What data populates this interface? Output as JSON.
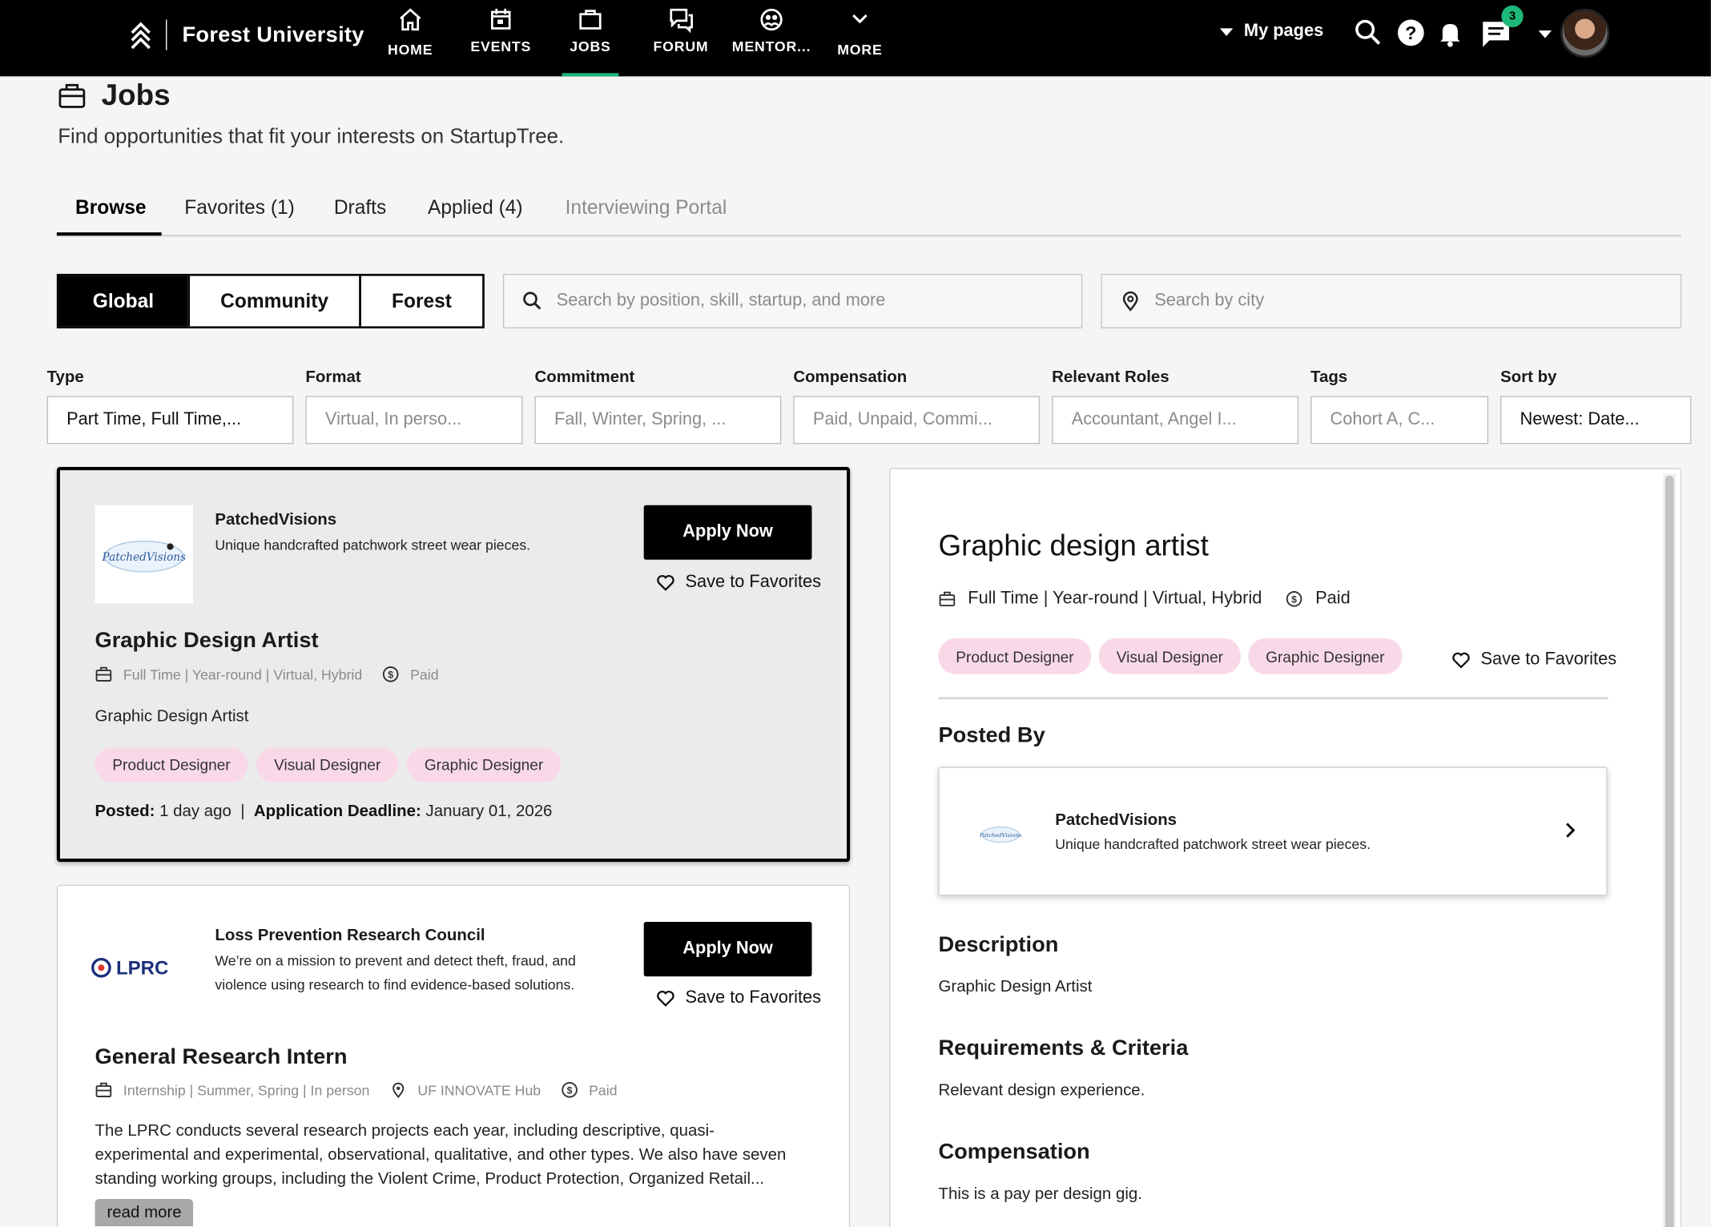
{
  "app": {
    "brand": "Forest University"
  },
  "nav": {
    "items": [
      {
        "label": "HOME",
        "icon": "home-icon"
      },
      {
        "label": "EVENTS",
        "icon": "calendar-icon"
      },
      {
        "label": "JOBS",
        "icon": "briefcase-icon",
        "active": true
      },
      {
        "label": "FORUM",
        "icon": "forum-icon"
      },
      {
        "label": "MENTOR...",
        "icon": "mentor-icon"
      },
      {
        "label": "MORE",
        "icon": "chevron-down-icon"
      }
    ],
    "my_pages": "My pages",
    "messages_badge": "3"
  },
  "page": {
    "title": "Jobs",
    "subtitle": "Find opportunities that fit your interests on StartupTree."
  },
  "tabs": [
    {
      "label": "Browse",
      "active": true
    },
    {
      "label": "Favorites (1)"
    },
    {
      "label": "Drafts"
    },
    {
      "label": "Applied (4)"
    },
    {
      "label": "Interviewing Portal",
      "disabled": true
    }
  ],
  "scope": {
    "options": [
      "Global",
      "Community",
      "Forest"
    ],
    "selected": "Global"
  },
  "search": {
    "placeholder": "Search by position, skill, startup, and more",
    "city_placeholder": "Search by city"
  },
  "filters": [
    {
      "label": "Type",
      "value": "Part Time, Full Time,..."
    },
    {
      "label": "Format",
      "value": "Virtual, In perso..."
    },
    {
      "label": "Commitment",
      "value": "Fall, Winter, Spring, ..."
    },
    {
      "label": "Compensation",
      "value": "Paid, Unpaid, Commi..."
    },
    {
      "label": "Relevant Roles",
      "value": "Accountant, Angel I..."
    },
    {
      "label": "Tags",
      "value": "Cohort A, C..."
    },
    {
      "label": "Sort by",
      "value": "Newest: Date..."
    }
  ],
  "jobs": [
    {
      "company": "PatchedVisions",
      "company_desc": "Unique handcrafted patchwork street wear pieces.",
      "logo_text": "PatchedVisions",
      "apply_label": "Apply Now",
      "fav_label": "Save to Favorites",
      "title": "Graphic Design Artist",
      "meta": "Full Time | Year-round | Virtual, Hybrid",
      "comp": "Paid",
      "description": "Graphic Design Artist",
      "tags": [
        "Product Designer",
        "Visual Designer",
        "Graphic Designer"
      ],
      "posted_label": "Posted:",
      "posted": "1 day ago",
      "deadline_label": "Application Deadline:",
      "deadline": "January 01, 2026"
    },
    {
      "company": "Loss Prevention Research Council",
      "company_desc_1": "We’re on a mission to prevent and detect theft, fraud, and",
      "company_desc_2": "violence using research to find evidence-based solutions.",
      "logo_text": "LPRC",
      "apply_label": "Apply Now",
      "fav_label": "Save to Favorites",
      "title": "General Research Intern",
      "meta": "Internship | Summer, Spring | In person",
      "location": "UF INNOVATE Hub",
      "comp": "Paid",
      "desc_1": "The LPRC conducts several research projects each year, including descriptive, quasi-",
      "desc_2": "experimental and experimental, observational, qualitative, and other types. We also have seven",
      "desc_3": "standing working groups, including the Violent Crime, Product Protection, Organized Retail...",
      "read_more": "read more"
    }
  ],
  "detail": {
    "title": "Graphic design artist",
    "meta": "Full Time | Year-round | Virtual, Hybrid",
    "comp": "Paid",
    "tags": [
      "Product Designer",
      "Visual Designer",
      "Graphic Designer"
    ],
    "fav_label": "Save to Favorites",
    "posted_by_heading": "Posted By",
    "poster_name": "PatchedVisions",
    "poster_desc": "Unique handcrafted patchwork street wear pieces.",
    "description_heading": "Description",
    "description": "Graphic Design Artist",
    "requirements_heading": "Requirements & Criteria",
    "requirements": "Relevant design experience.",
    "compensation_heading": "Compensation",
    "compensation": "This is a pay per design gig."
  },
  "colors": {
    "nav_bg": "#000000",
    "accent": "#1db87a",
    "pill_bg": "#f9d9e8",
    "selected_card_bg": "#ebebeb"
  }
}
